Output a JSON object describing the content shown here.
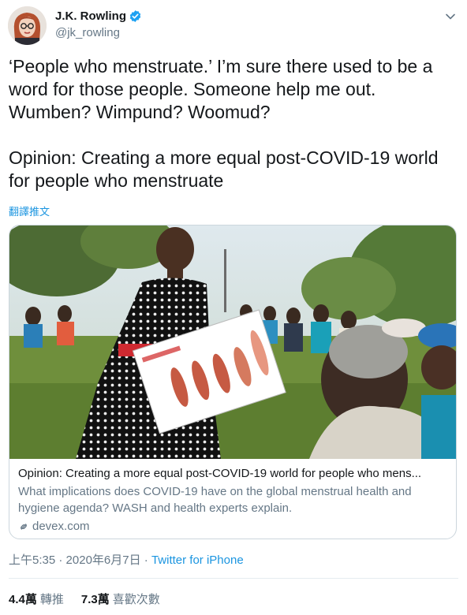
{
  "author": {
    "display_name": "J.K. Rowling",
    "handle": "@jk_rowling",
    "verified": true,
    "avatar_icon": "profile-photo"
  },
  "tweet": {
    "line1": "‘People who menstruate.’ I’m sure there used to be a word for those people. Someone help me out. Wumben? Wimpund? Woomud?",
    "line2": "Opinion: Creating a more equal post-COVID-19 world for people who menstruate",
    "translate_label": "翻譯推文"
  },
  "card": {
    "title": "Opinion: Creating a more equal post-COVID-19 world for people who mens...",
    "description": "What implications does COVID-19 have on the global menstrual health and hygiene agenda? WASH and health experts explain.",
    "domain": "devex.com",
    "domain_icon": "link-icon"
  },
  "meta": {
    "time": "上午5:35",
    "separator": " · ",
    "date": "2020年6月7日",
    "source": "Twitter for iPhone"
  },
  "stats": {
    "retweets_count": "4.4萬",
    "retweets_label": "轉推",
    "likes_count": "7.3萬",
    "likes_label": "喜歡次數"
  },
  "colors": {
    "link": "#1b95e0",
    "secondary": "#657786",
    "verified": "#1da1f2"
  }
}
